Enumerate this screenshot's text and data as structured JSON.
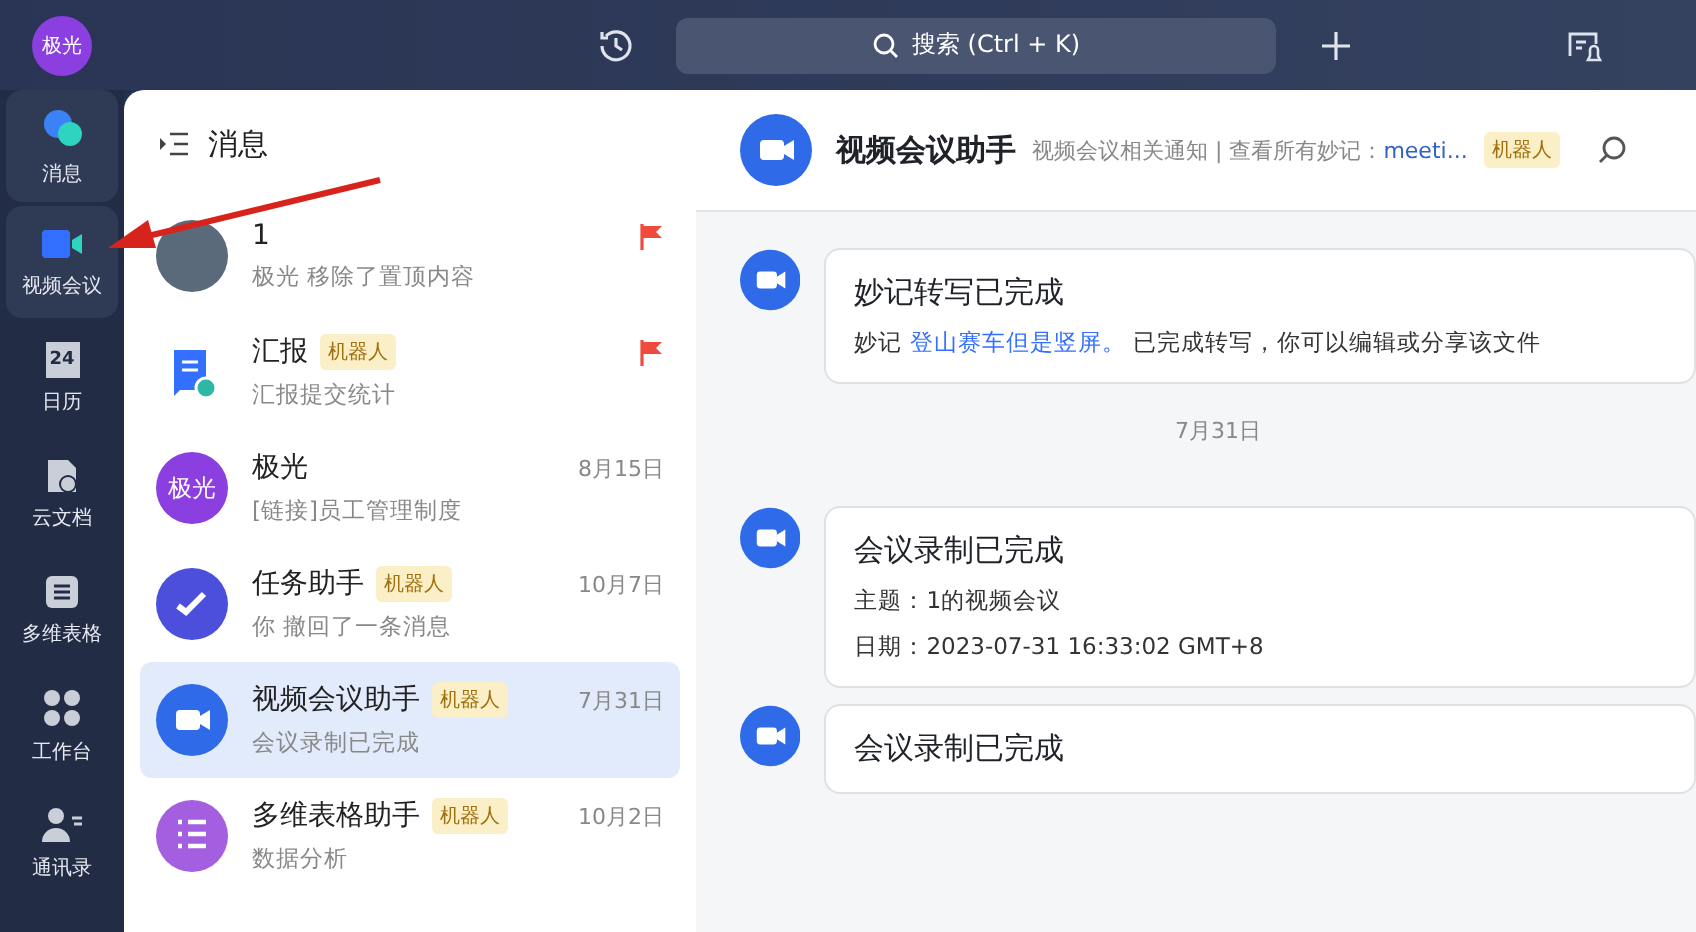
{
  "user_avatar": "极光",
  "search": {
    "placeholder": "搜索 (Ctrl + K)"
  },
  "nav": [
    {
      "label": "消息",
      "highlighted": true
    },
    {
      "label": "视频会议",
      "highlighted": true
    },
    {
      "label": "日历",
      "highlighted": false,
      "day": "24"
    },
    {
      "label": "云文档",
      "highlighted": false
    },
    {
      "label": "多维表格",
      "highlighted": false
    },
    {
      "label": "工作台",
      "highlighted": false
    },
    {
      "label": "通讯录",
      "highlighted": false
    }
  ],
  "list_title": "消息",
  "chats": [
    {
      "name": "1",
      "preview": "极光 移除了置顶内容",
      "flagged": true,
      "selected": false
    },
    {
      "name": "汇报",
      "tag": "机器人",
      "preview": "汇报提交统计",
      "flagged": true,
      "selected": false
    },
    {
      "avatar_text": "极光",
      "name": "极光",
      "preview": "[链接]员工管理制度",
      "time": "8月15日",
      "flagged": false,
      "selected": false
    },
    {
      "name": "任务助手",
      "tag": "机器人",
      "preview": "你 撤回了一条消息",
      "time": "10月7日",
      "flagged": false,
      "selected": false
    },
    {
      "name": "视频会议助手",
      "tag": "机器人",
      "preview": "会议录制已完成",
      "time": "7月31日",
      "flagged": false,
      "selected": true
    },
    {
      "name": "多维表格助手",
      "tag": "机器人",
      "preview": "数据分析",
      "time": "10月2日",
      "flagged": false,
      "selected": false
    }
  ],
  "chat": {
    "title": "视频会议助手",
    "subtitle": "视频会议相关通知 | 查看所有妙记：",
    "link": "meeti...",
    "tag": "机器人",
    "entries": [
      {
        "kind": "card",
        "title": "妙记转写已完成",
        "lines": [
          {
            "parts": [
              {
                "kind": "text",
                "text": "妙记 "
              },
              {
                "kind": "link",
                "text": "登山赛车但是竖屏。"
              },
              {
                "kind": "text",
                "text": " 已完成转写，你可以编辑或分享该文件"
              }
            ]
          }
        ]
      },
      {
        "kind": "date",
        "text": "7月31日"
      },
      {
        "kind": "card",
        "title": "会议录制已完成",
        "lines": [
          {
            "parts": [
              {
                "kind": "text",
                "text": "主题：1的视频会议"
              }
            ]
          },
          {
            "parts": [
              {
                "kind": "text",
                "text": "日期：2023-07-31 16:33:02 GMT+8"
              }
            ]
          }
        ]
      },
      {
        "kind": "card",
        "title": "会议录制已完成"
      }
    ]
  }
}
